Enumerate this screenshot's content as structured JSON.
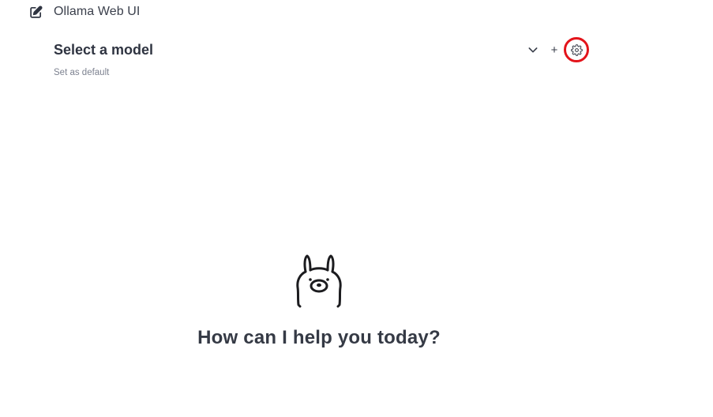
{
  "header": {
    "title": "Ollama Web UI",
    "new_chat_icon": "pencil-square-icon"
  },
  "model_selector": {
    "label": "Select a model",
    "set_default_label": "Set as default",
    "chevron_icon": "chevron-down-icon",
    "add_label": "+",
    "settings_icon": "gear-icon",
    "settings_highlight_color": "#e3141b"
  },
  "main": {
    "logo_icon": "ollama-llama-logo",
    "greeting": "How can I help you today?"
  }
}
